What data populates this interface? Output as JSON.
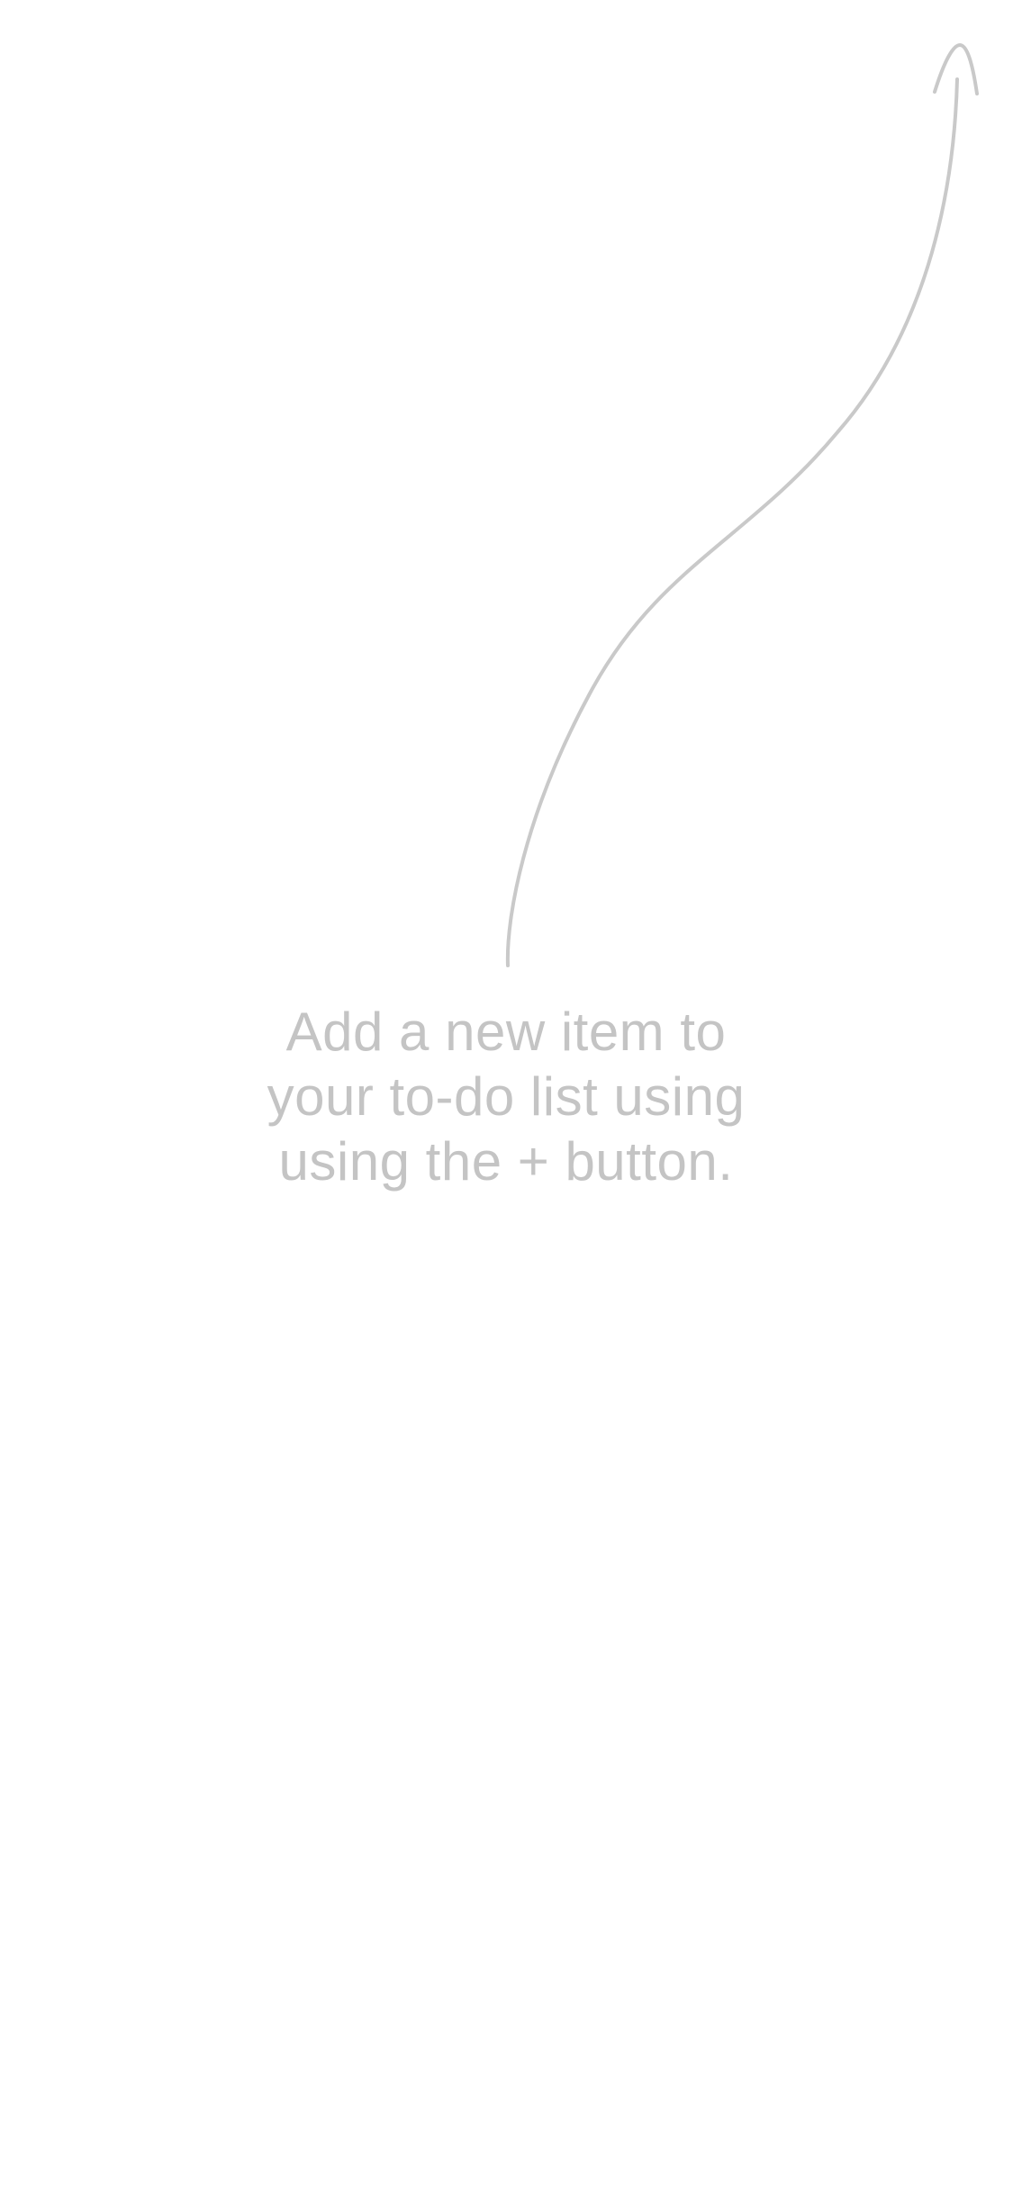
{
  "empty_state": {
    "hint_lines": [
      "Add a new item to",
      "your to-do list using",
      "using the + button."
    ],
    "arrow_icon": "curved-arrow-up-icon",
    "text_color": "#c4c4c4",
    "arrow_color": "#c9c9c9"
  }
}
